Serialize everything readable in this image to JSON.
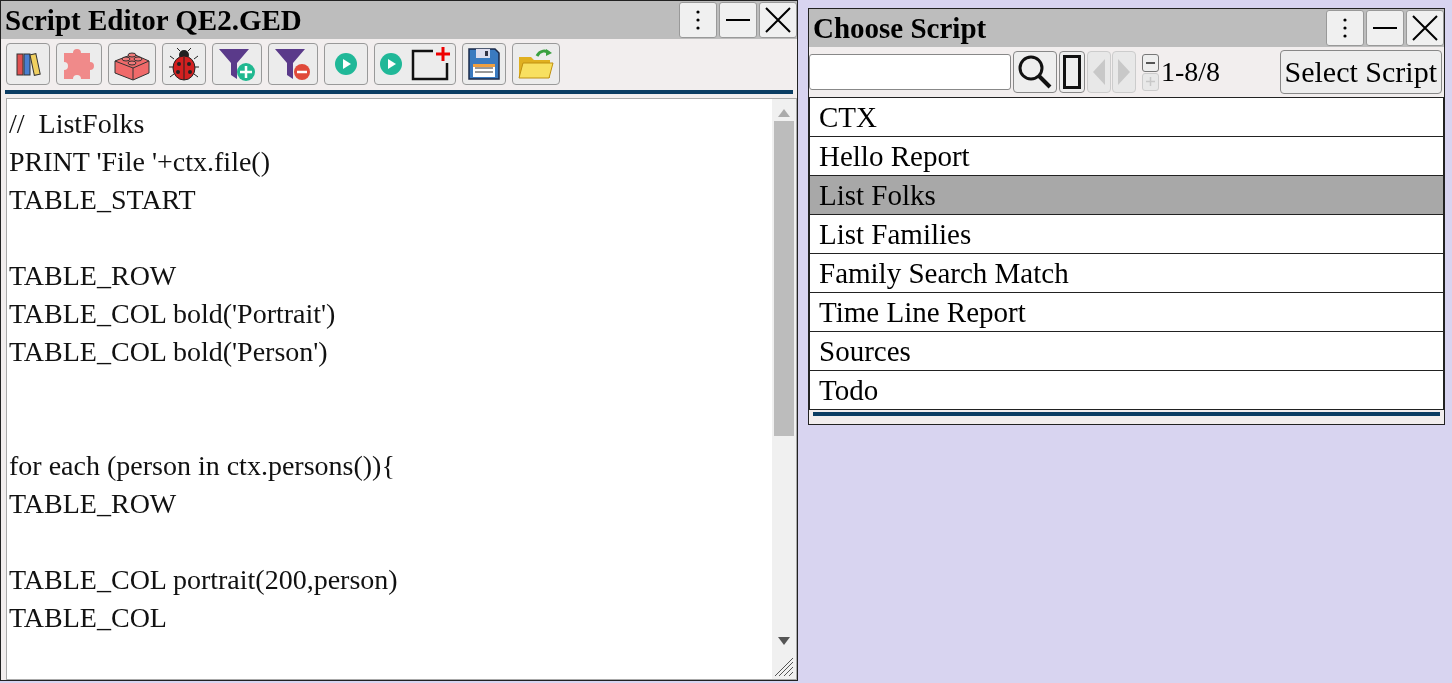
{
  "editor": {
    "title": "Script Editor QE2.GED",
    "code": "//  ListFolks\nPRINT 'File '+ctx.file()\nTABLE_START\n\nTABLE_ROW\nTABLE_COL bold('Portrait')\nTABLE_COL bold('Person')\n\n\nfor each (person in ctx.persons()){\nTABLE_ROW\n\nTABLE_COL portrait(200,person)\nTABLE_COL"
  },
  "chooser": {
    "title": "Choose Script",
    "nav": [
      {
        "kind": "prev",
        "disabled": true
      },
      {
        "kind": "next",
        "disabled": true
      }
    ],
    "zoom": [
      {
        "kind": "minus",
        "disabled": false
      },
      {
        "kind": "plus",
        "disabled": true
      }
    ],
    "count": "1-8/8",
    "select_button": "Select Script",
    "items": [
      {
        "label": "CTX",
        "selected": false
      },
      {
        "label": "Hello Report",
        "selected": false
      },
      {
        "label": "List Folks",
        "selected": true
      },
      {
        "label": "List Families",
        "selected": false
      },
      {
        "label": "Family Search Match",
        "selected": false
      },
      {
        "label": "Time Line Report",
        "selected": false
      },
      {
        "label": "Sources",
        "selected": false
      },
      {
        "label": "Todo",
        "selected": false
      }
    ]
  }
}
